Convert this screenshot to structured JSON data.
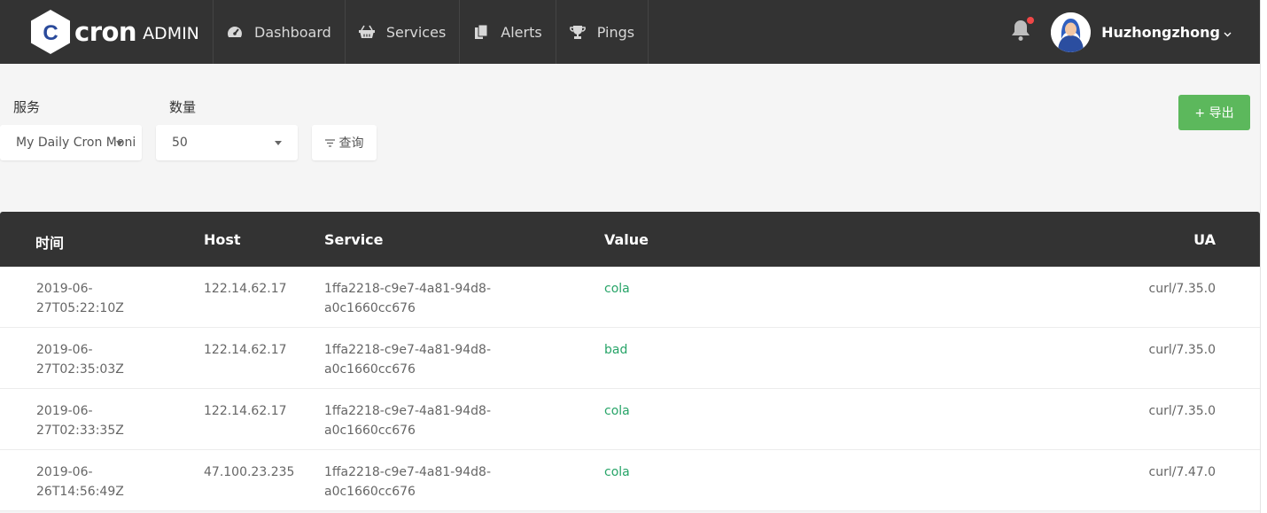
{
  "brand": {
    "letter": "C",
    "word": "cron",
    "suffix": "ADMIN"
  },
  "nav": [
    {
      "label": "Dashboard",
      "icon": "dashboard-gauge-icon"
    },
    {
      "label": "Services",
      "icon": "basket-icon"
    },
    {
      "label": "Alerts",
      "icon": "documents-icon"
    },
    {
      "label": "Pings",
      "icon": "trophy-icon"
    }
  ],
  "header": {
    "username": "Huzhongzhong",
    "notification_icon": "bell-icon",
    "has_unread": true
  },
  "filters": {
    "service_label": "服务",
    "service_value": "My Daily Cron Moni...",
    "count_label": "数量",
    "count_value": "50",
    "query_label": "查询",
    "export_label": "+ 导出"
  },
  "table": {
    "headers": {
      "time": "时间",
      "host": "Host",
      "service": "Service",
      "value": "Value",
      "ua": "UA"
    },
    "rows": [
      {
        "time_a": "2019-06-",
        "time_b": "27T05:22:10Z",
        "host": "122.14.62.17",
        "svc_a": "1ffa2218-c9e7-4a81-94d8-",
        "svc_b": "a0c1660cc676",
        "value": "cola",
        "ua": "curl/7.35.0"
      },
      {
        "time_a": "2019-06-",
        "time_b": "27T02:35:03Z",
        "host": "122.14.62.17",
        "svc_a": "1ffa2218-c9e7-4a81-94d8-",
        "svc_b": "a0c1660cc676",
        "value": "bad",
        "ua": "curl/7.35.0"
      },
      {
        "time_a": "2019-06-",
        "time_b": "27T02:33:35Z",
        "host": "122.14.62.17",
        "svc_a": "1ffa2218-c9e7-4a81-94d8-",
        "svc_b": "a0c1660cc676",
        "value": "cola",
        "ua": "curl/7.35.0"
      },
      {
        "time_a": "2019-06-",
        "time_b": "26T14:56:49Z",
        "host": "47.100.23.235",
        "svc_a": "1ffa2218-c9e7-4a81-94d8-",
        "svc_b": "a0c1660cc676",
        "value": "cola",
        "ua": "curl/7.47.0"
      }
    ]
  },
  "colors": {
    "header_bg": "#333333",
    "accent_green": "#5cb85c",
    "value_green": "#27a468",
    "notify_red": "#f04747",
    "brand_blue": "#2a4a9b"
  }
}
